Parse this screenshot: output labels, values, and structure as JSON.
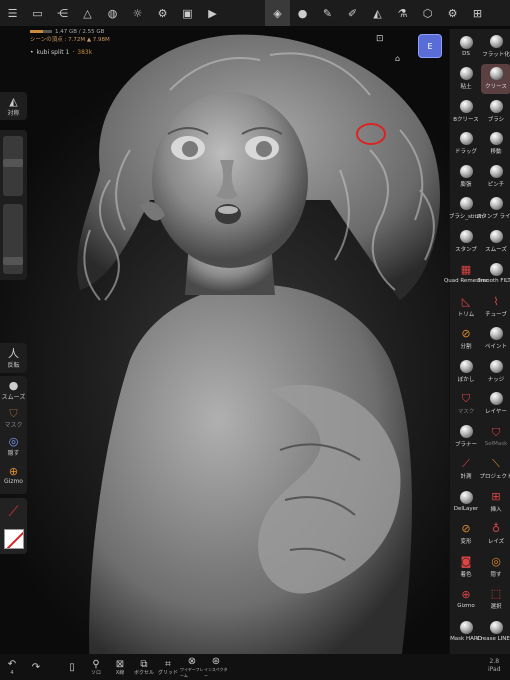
{
  "topbar": {
    "left_icons": [
      "menu-icon",
      "folder-icon",
      "share-icon",
      "mesh-icon",
      "globe-icon",
      "sun-icon",
      "settings-wheel-icon",
      "image-icon",
      "video-icon"
    ],
    "right_icons": [
      "layers-stack-icon",
      "material-sphere-icon",
      "stroke-icon",
      "paint-brush-icon",
      "triangle-icon",
      "flask-icon",
      "cube-icon",
      "gear-icon",
      "scene-icon"
    ]
  },
  "info": {
    "memory": "1.47 GB / 2.55 GB",
    "scene_stats": "シーンの頂点 : 7.72M   ▲ 7.98M",
    "layer_name": "kubi split 1",
    "layer_count": "383k",
    "memory_fraction": 0.58
  },
  "viewcube": {
    "label": "E"
  },
  "left_toolbar": {
    "symmetry_label": "対称",
    "invert_label": "反転",
    "smooth_label": "スムーズ",
    "mask_label": "マスク",
    "hide_label": "隠す",
    "gizmo_label": "Gizmo",
    "radius_value": 0.55,
    "strength_value": 0.15
  },
  "right_tools": [
    {
      "label": "DS",
      "name": "ds-tool",
      "icon": "ball",
      "sel": false
    },
    {
      "label": "フラット化",
      "name": "flatten-tool",
      "icon": "ball",
      "sel": false
    },
    {
      "label": "粘土",
      "name": "clay-tool",
      "icon": "ball",
      "sel": false
    },
    {
      "label": "クリース",
      "name": "crease-tool",
      "icon": "ball",
      "sel": true
    },
    {
      "label": "Bクリース",
      "name": "bcrease-tool",
      "icon": "ball",
      "sel": false
    },
    {
      "label": "ブラシ",
      "name": "brush-tool",
      "icon": "ball",
      "sel": false
    },
    {
      "label": "ドラッグ",
      "name": "drag-tool",
      "icon": "ball",
      "sel": false
    },
    {
      "label": "移動",
      "name": "move-tool",
      "icon": "ball",
      "sel": false
    },
    {
      "label": "膨張",
      "name": "inflate-tool",
      "icon": "ball",
      "sel": false
    },
    {
      "label": "ピンチ",
      "name": "pinch-tool",
      "icon": "ball",
      "sel": false
    },
    {
      "label": "ブラシ_stitch",
      "name": "brush-stitch-tool",
      "icon": "ball",
      "sel": false
    },
    {
      "label": "スタンプ ライン",
      "name": "stamp-line-tool",
      "icon": "ball",
      "sel": false
    },
    {
      "label": "スタンプ",
      "name": "stamp-tool",
      "icon": "ball",
      "sel": false
    },
    {
      "label": "スムーズ",
      "name": "smooth-tool",
      "icon": "ball",
      "sel": false
    },
    {
      "label": "Quad Remesher",
      "name": "quad-remesher-tool",
      "icon": "▦",
      "sel": false
    },
    {
      "label": "Smooth FILTR",
      "name": "smooth-filter-tool",
      "icon": "ball",
      "sel": false
    },
    {
      "label": "トリム",
      "name": "trim-tool",
      "icon": "◺",
      "sel": false
    },
    {
      "label": "チューブ",
      "name": "tube-tool",
      "icon": "⌇",
      "sel": false
    },
    {
      "label": "分割",
      "name": "split-tool",
      "icon": "⊘",
      "sel": false
    },
    {
      "label": "ペイント",
      "name": "paint-tool",
      "icon": "ball",
      "sel": false
    },
    {
      "label": "ぼかし",
      "name": "blur-tool",
      "icon": "ball",
      "sel": false
    },
    {
      "label": "ナッジ",
      "name": "nudge-tool",
      "icon": "ball",
      "sel": false
    },
    {
      "label": "マスク",
      "name": "mask-tool",
      "icon": "⛉",
      "sel": false,
      "dim": true
    },
    {
      "label": "レイヤー",
      "name": "layer-tool",
      "icon": "ball",
      "sel": false
    },
    {
      "label": "ブラナー",
      "name": "planar-tool",
      "icon": "ball",
      "sel": false
    },
    {
      "label": "SelMask",
      "name": "selmask-tool",
      "icon": "⛉",
      "sel": false,
      "dim": true
    },
    {
      "label": "計測",
      "name": "measure-tool",
      "icon": "⟋",
      "sel": false
    },
    {
      "label": "プロジェクト",
      "name": "project-tool",
      "icon": "⟍",
      "sel": false
    },
    {
      "label": "DelLayer",
      "name": "del-layer-tool",
      "icon": "ball",
      "sel": false
    },
    {
      "label": "挿入",
      "name": "insert-tool",
      "icon": "⊞",
      "sel": false
    },
    {
      "label": "変形",
      "name": "transform-tool",
      "icon": "⊘",
      "sel": false
    },
    {
      "label": "レイズ",
      "name": "raise-tool",
      "icon": "♁",
      "sel": false
    },
    {
      "label": "着色",
      "name": "color-tool",
      "icon": "◙",
      "sel": false
    },
    {
      "label": "隠す",
      "name": "hide-tool",
      "icon": "◎",
      "sel": false
    },
    {
      "label": "Gizmo",
      "name": "gizmo-tool",
      "icon": "⊕",
      "sel": false
    },
    {
      "label": "選択",
      "name": "select-tool",
      "icon": "⬚",
      "sel": false
    },
    {
      "label": "Mask HARD",
      "name": "mask-hard-tool",
      "icon": "ball",
      "sel": false
    },
    {
      "label": "Crease LINE 2",
      "name": "crease-line-tool",
      "icon": "ball",
      "sel": false
    }
  ],
  "bottombar": [
    {
      "label": "",
      "name": "undo-button",
      "icon": "↶",
      "sub": "4"
    },
    {
      "label": "",
      "name": "redo-button",
      "icon": "↷",
      "sub": ""
    },
    {
      "label": "",
      "name": "spacer",
      "icon": "",
      "sub": ""
    },
    {
      "label": "",
      "name": "phone-button",
      "icon": "▯",
      "sub": ""
    },
    {
      "label": "ソロ",
      "name": "solo-button",
      "icon": "⚲",
      "sub": ""
    },
    {
      "label": "X線",
      "name": "xray-button",
      "icon": "⊠",
      "sub": ""
    },
    {
      "label": "ボクセル",
      "name": "voxel-button",
      "icon": "⧉",
      "sub": ""
    },
    {
      "label": "グリッド",
      "name": "grid-button",
      "icon": "⌗",
      "sub": ""
    },
    {
      "label": "ワイヤーフレーム",
      "name": "wireframe-button",
      "icon": "⊗",
      "sub": ""
    },
    {
      "label": "インスペクター",
      "name": "inspector-button",
      "icon": "⊛",
      "sub": ""
    }
  ],
  "version": {
    "number": "2.8",
    "device": "iPad"
  }
}
